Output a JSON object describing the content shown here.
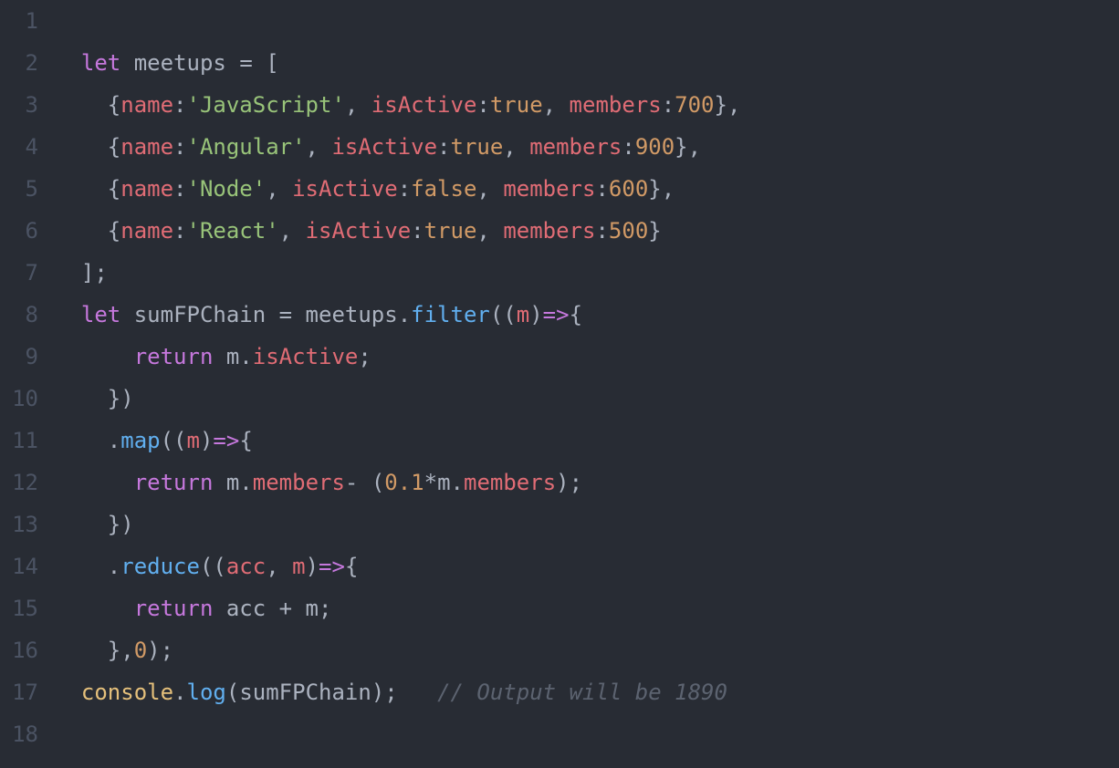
{
  "editor": {
    "lineNumbers": [
      "1",
      "2",
      "3",
      "4",
      "5",
      "6",
      "7",
      "8",
      "9",
      "10",
      "11",
      "12",
      "13",
      "14",
      "15",
      "16",
      "17",
      "18"
    ],
    "lines": [
      [],
      [
        {
          "t": "  ",
          "c": "tk-pun"
        },
        {
          "t": "let",
          "c": "tk-kw"
        },
        {
          "t": " meetups ",
          "c": "tk-op"
        },
        {
          "t": "=",
          "c": "tk-op"
        },
        {
          "t": " [",
          "c": "tk-op"
        }
      ],
      [
        {
          "t": "    {",
          "c": "tk-op"
        },
        {
          "t": "name",
          "c": "tk-prop"
        },
        {
          "t": ":",
          "c": "tk-op"
        },
        {
          "t": "'JavaScript'",
          "c": "tk-str"
        },
        {
          "t": ", ",
          "c": "tk-op"
        },
        {
          "t": "isActive",
          "c": "tk-prop"
        },
        {
          "t": ":",
          "c": "tk-op"
        },
        {
          "t": "true",
          "c": "tk-bool"
        },
        {
          "t": ", ",
          "c": "tk-op"
        },
        {
          "t": "members",
          "c": "tk-prop"
        },
        {
          "t": ":",
          "c": "tk-op"
        },
        {
          "t": "700",
          "c": "tk-num"
        },
        {
          "t": "},",
          "c": "tk-op"
        }
      ],
      [
        {
          "t": "    {",
          "c": "tk-op"
        },
        {
          "t": "name",
          "c": "tk-prop"
        },
        {
          "t": ":",
          "c": "tk-op"
        },
        {
          "t": "'Angular'",
          "c": "tk-str"
        },
        {
          "t": ", ",
          "c": "tk-op"
        },
        {
          "t": "isActive",
          "c": "tk-prop"
        },
        {
          "t": ":",
          "c": "tk-op"
        },
        {
          "t": "true",
          "c": "tk-bool"
        },
        {
          "t": ", ",
          "c": "tk-op"
        },
        {
          "t": "members",
          "c": "tk-prop"
        },
        {
          "t": ":",
          "c": "tk-op"
        },
        {
          "t": "900",
          "c": "tk-num"
        },
        {
          "t": "},",
          "c": "tk-op"
        }
      ],
      [
        {
          "t": "    {",
          "c": "tk-op"
        },
        {
          "t": "name",
          "c": "tk-prop"
        },
        {
          "t": ":",
          "c": "tk-op"
        },
        {
          "t": "'Node'",
          "c": "tk-str"
        },
        {
          "t": ", ",
          "c": "tk-op"
        },
        {
          "t": "isActive",
          "c": "tk-prop"
        },
        {
          "t": ":",
          "c": "tk-op"
        },
        {
          "t": "false",
          "c": "tk-bool"
        },
        {
          "t": ", ",
          "c": "tk-op"
        },
        {
          "t": "members",
          "c": "tk-prop"
        },
        {
          "t": ":",
          "c": "tk-op"
        },
        {
          "t": "600",
          "c": "tk-num"
        },
        {
          "t": "},",
          "c": "tk-op"
        }
      ],
      [
        {
          "t": "    {",
          "c": "tk-op"
        },
        {
          "t": "name",
          "c": "tk-prop"
        },
        {
          "t": ":",
          "c": "tk-op"
        },
        {
          "t": "'React'",
          "c": "tk-str"
        },
        {
          "t": ", ",
          "c": "tk-op"
        },
        {
          "t": "isActive",
          "c": "tk-prop"
        },
        {
          "t": ":",
          "c": "tk-op"
        },
        {
          "t": "true",
          "c": "tk-bool"
        },
        {
          "t": ", ",
          "c": "tk-op"
        },
        {
          "t": "members",
          "c": "tk-prop"
        },
        {
          "t": ":",
          "c": "tk-op"
        },
        {
          "t": "500",
          "c": "tk-num"
        },
        {
          "t": "}",
          "c": "tk-op"
        }
      ],
      [
        {
          "t": "  ];",
          "c": "tk-op"
        }
      ],
      [
        {
          "t": "  ",
          "c": "tk-op"
        },
        {
          "t": "let",
          "c": "tk-kw"
        },
        {
          "t": " sumFPChain ",
          "c": "tk-op"
        },
        {
          "t": "=",
          "c": "tk-op"
        },
        {
          "t": " meetups.",
          "c": "tk-op"
        },
        {
          "t": "filter",
          "c": "tk-fn"
        },
        {
          "t": "((",
          "c": "tk-op"
        },
        {
          "t": "m",
          "c": "tk-var"
        },
        {
          "t": ")",
          "c": "tk-op"
        },
        {
          "t": "=>",
          "c": "tk-arrow"
        },
        {
          "t": "{",
          "c": "tk-op"
        }
      ],
      [
        {
          "t": "      ",
          "c": "tk-op"
        },
        {
          "t": "return",
          "c": "tk-kw"
        },
        {
          "t": " m.",
          "c": "tk-op"
        },
        {
          "t": "isActive",
          "c": "tk-prop"
        },
        {
          "t": ";",
          "c": "tk-op"
        }
      ],
      [
        {
          "t": "    })",
          "c": "tk-op"
        }
      ],
      [
        {
          "t": "    .",
          "c": "tk-op"
        },
        {
          "t": "map",
          "c": "tk-fn"
        },
        {
          "t": "((",
          "c": "tk-op"
        },
        {
          "t": "m",
          "c": "tk-var"
        },
        {
          "t": ")",
          "c": "tk-op"
        },
        {
          "t": "=>",
          "c": "tk-arrow"
        },
        {
          "t": "{",
          "c": "tk-op"
        }
      ],
      [
        {
          "t": "      ",
          "c": "tk-op"
        },
        {
          "t": "return",
          "c": "tk-kw"
        },
        {
          "t": " m.",
          "c": "tk-op"
        },
        {
          "t": "members",
          "c": "tk-prop"
        },
        {
          "t": "- (",
          "c": "tk-op"
        },
        {
          "t": "0.1",
          "c": "tk-num"
        },
        {
          "t": "*",
          "c": "tk-op"
        },
        {
          "t": "m.",
          "c": "tk-op"
        },
        {
          "t": "members",
          "c": "tk-prop"
        },
        {
          "t": ");",
          "c": "tk-op"
        }
      ],
      [
        {
          "t": "    })",
          "c": "tk-op"
        }
      ],
      [
        {
          "t": "    .",
          "c": "tk-op"
        },
        {
          "t": "reduce",
          "c": "tk-fn"
        },
        {
          "t": "((",
          "c": "tk-op"
        },
        {
          "t": "acc",
          "c": "tk-var"
        },
        {
          "t": ", ",
          "c": "tk-op"
        },
        {
          "t": "m",
          "c": "tk-var"
        },
        {
          "t": ")",
          "c": "tk-op"
        },
        {
          "t": "=>",
          "c": "tk-arrow"
        },
        {
          "t": "{",
          "c": "tk-op"
        }
      ],
      [
        {
          "t": "      ",
          "c": "tk-op"
        },
        {
          "t": "return",
          "c": "tk-kw"
        },
        {
          "t": " acc ",
          "c": "tk-op"
        },
        {
          "t": "+",
          "c": "tk-op"
        },
        {
          "t": " m;",
          "c": "tk-op"
        }
      ],
      [
        {
          "t": "    },",
          "c": "tk-op"
        },
        {
          "t": "0",
          "c": "tk-num"
        },
        {
          "t": ");",
          "c": "tk-op"
        }
      ],
      [
        {
          "t": "  ",
          "c": "tk-op"
        },
        {
          "t": "console",
          "c": "tk-obj"
        },
        {
          "t": ".",
          "c": "tk-op"
        },
        {
          "t": "log",
          "c": "tk-fn"
        },
        {
          "t": "(sumFPChain);   ",
          "c": "tk-op"
        },
        {
          "t": "// Output will be 1890",
          "c": "tk-cmt"
        }
      ],
      []
    ]
  }
}
